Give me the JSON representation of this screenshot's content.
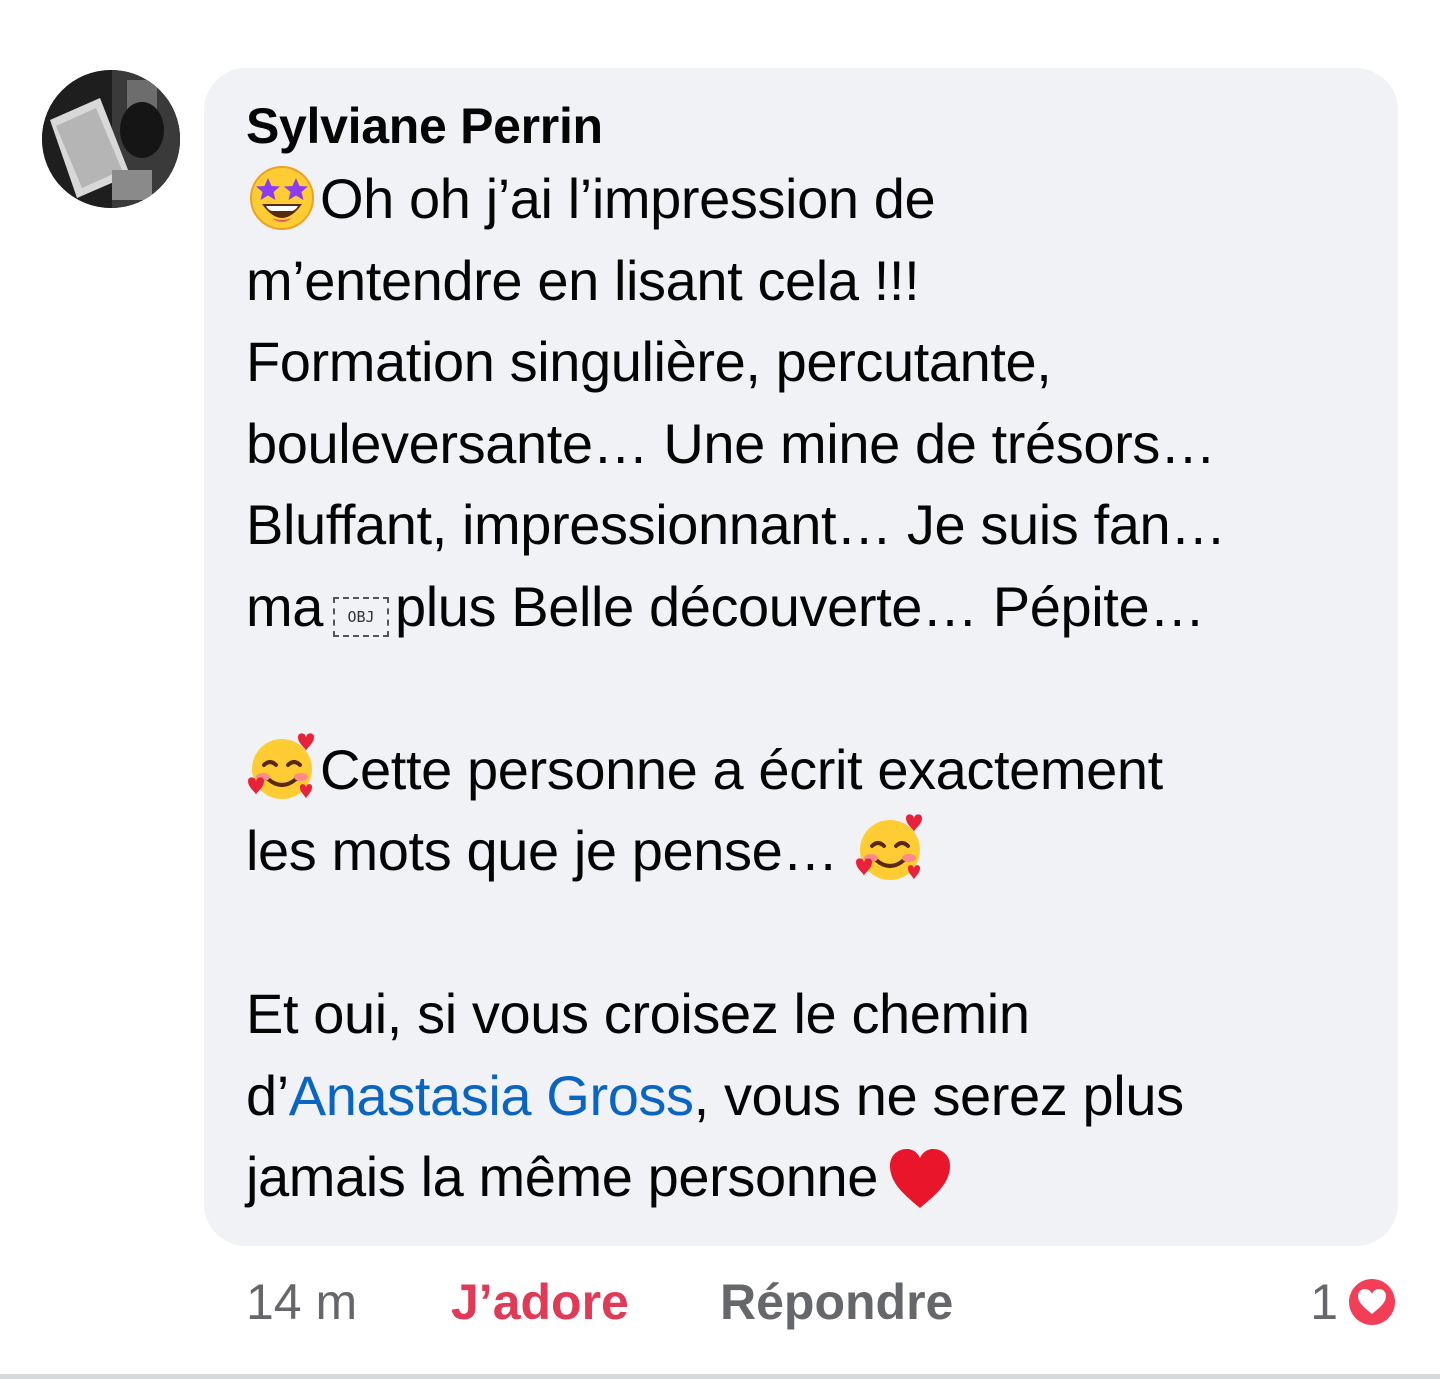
{
  "comment": {
    "author": "Sylviane Perrin",
    "lines": [
      "Oh oh j’ai l’impression de",
      "m’entendre en lisant cela !!!",
      "Formation singulière, percutante,",
      "bouleversante… Une mine de trésors…",
      "Bluffant, impressionnant… Je suis fan…",
      "ma",
      "plus Belle découverte… Pépite…",
      "Cette personne a écrit exactement",
      "les mots que je pense…",
      "Et oui, si vous croisez le chemin",
      "d’",
      "Anastasia Gross",
      ", vous ne serez plus",
      "jamais la même personne"
    ],
    "obj_placeholder": "OBJ",
    "emoji": {
      "first": "star-struck",
      "hearts_face": "smiling-face-with-hearts",
      "end": "red-heart"
    }
  },
  "actions": {
    "time": "14 m",
    "love": "J’adore",
    "reply": "Répondre"
  },
  "reaction": {
    "count": "1",
    "icon": "love-reaction"
  },
  "colors": {
    "bubble": "#f0f2f5",
    "mention": "#0a65c2",
    "love": "#e03a57",
    "meta": "#65676b"
  }
}
